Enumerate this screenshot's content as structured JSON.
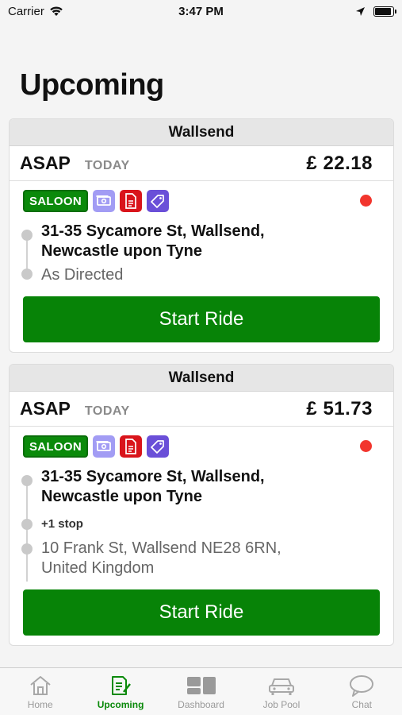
{
  "status_bar": {
    "carrier": "Carrier",
    "time": "3:47 PM"
  },
  "page_title": "Upcoming",
  "rides": [
    {
      "area": "Wallsend",
      "when": "ASAP",
      "day": "TODAY",
      "price": "£ 22.18",
      "vehicle": "SALOON",
      "pickup": "31-35 Sycamore St, Wallsend, Newcastle upon Tyne",
      "extra_stops": "",
      "dropoff": "As Directed",
      "action": "Start Ride"
    },
    {
      "area": "Wallsend",
      "when": "ASAP",
      "day": "TODAY",
      "price": "£ 51.73",
      "vehicle": "SALOON",
      "pickup": "31-35 Sycamore St, Wallsend, Newcastle upon Tyne",
      "extra_stops": "+1 stop",
      "dropoff": "10 Frank St, Wallsend NE28 6RN, United Kingdom",
      "action": "Start Ride"
    }
  ],
  "tabs": [
    {
      "label": "Home",
      "icon": "home-icon"
    },
    {
      "label": "Upcoming",
      "icon": "upcoming-icon",
      "active": true
    },
    {
      "label": "Dashboard",
      "icon": "dashboard-icon"
    },
    {
      "label": "Job Pool",
      "icon": "car-icon"
    },
    {
      "label": "Chat",
      "icon": "chat-icon"
    }
  ],
  "colors": {
    "accent": "#078307",
    "alert": "#f2352d",
    "cash": "#a29cf4",
    "document": "#d9141b",
    "tag": "#6a4fd8"
  }
}
